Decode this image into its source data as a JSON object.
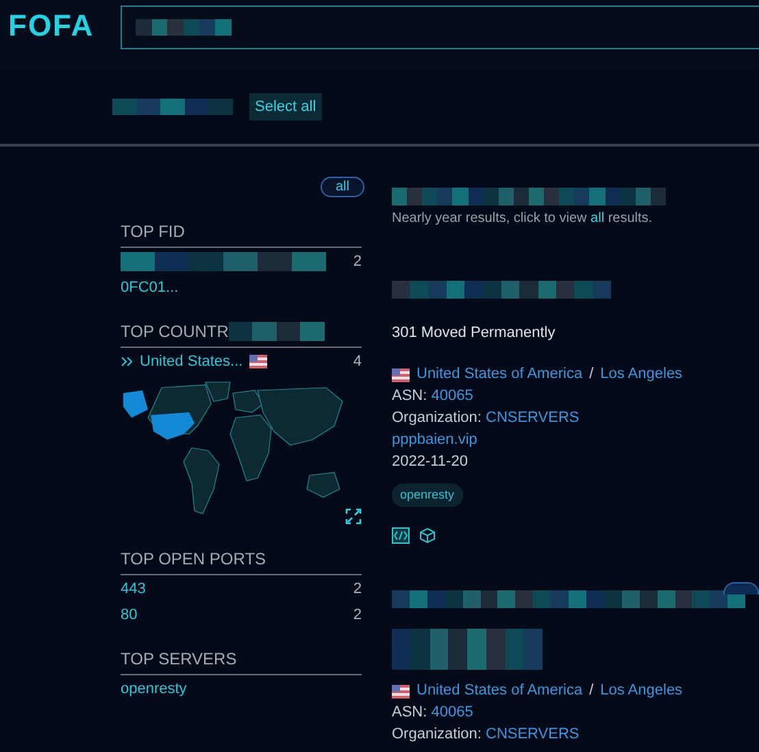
{
  "logo": "FOFA",
  "filter": {
    "button": "Select all"
  },
  "sidebar": {
    "scope_button": "all",
    "sections": [
      {
        "kind": "list",
        "title": "TOP FID",
        "title_masked": false,
        "rows": [
          {
            "kind": "masked",
            "count": "2"
          },
          {
            "kind": "text",
            "label": "0FC01..."
          }
        ]
      },
      {
        "kind": "map",
        "title": "TOP COUNTR",
        "title_masked": true,
        "rows": [
          {
            "kind": "country",
            "label": "United States...",
            "count": "4"
          }
        ]
      },
      {
        "kind": "list",
        "title": "TOP OPEN PORTS",
        "title_masked": false,
        "rows": [
          {
            "kind": "text",
            "label": "443",
            "count": "2"
          },
          {
            "kind": "text",
            "label": "80",
            "count": "2"
          }
        ]
      },
      {
        "kind": "list",
        "title": "TOP SERVERS",
        "title_masked": false,
        "rows": [
          {
            "kind": "text",
            "label": "openresty"
          }
        ]
      }
    ]
  },
  "notice": {
    "before": "Nearly year results, click to view ",
    "link": "all",
    "after": " results."
  },
  "results": [
    {
      "status": "301 Moved Permanently",
      "country": "United States of America",
      "separator": "/",
      "city": "Los Angeles",
      "asn_label": "ASN:",
      "asn": "40065",
      "org_label": "Organization:",
      "org": "CNSERVERS",
      "domain": "pppbaien.vip",
      "date": "2022-11-20",
      "tags": [
        "openresty"
      ],
      "actions": [
        {
          "kind": "code"
        },
        {
          "kind": "cube"
        }
      ],
      "badge": false
    },
    {
      "country": "United States of America",
      "separator": "/",
      "city": "Los Angeles",
      "asn_label": "ASN:",
      "asn": "40065",
      "org_label": "Organization:",
      "org": "CNSERVERS",
      "badge": true
    }
  ]
}
